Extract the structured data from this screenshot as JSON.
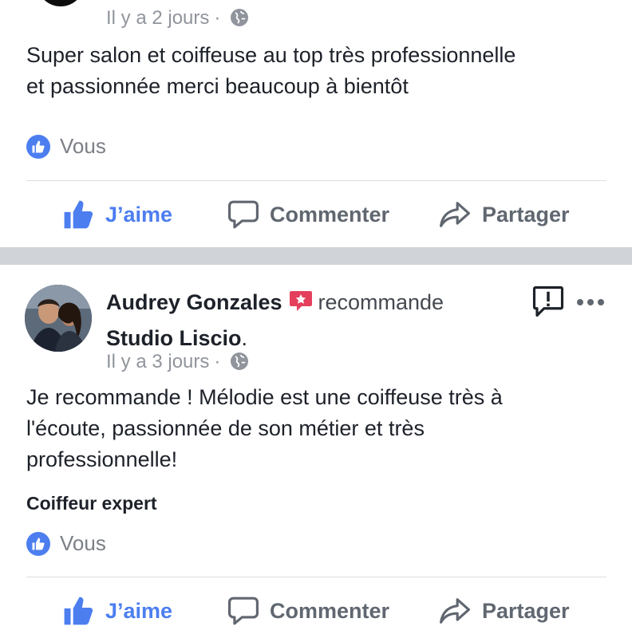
{
  "post1": {
    "time": "Il y a 2 jours",
    "text_line1": "Super salon et coiffeuse au top très professionnelle",
    "text_line2": "et passionnée merci beaucoup à bientôt",
    "reactions": "Vous"
  },
  "post2": {
    "author": "Audrey Gonzales",
    "verb": "recommande",
    "page": "Studio Liscio",
    "time": "Il y a 3 jours",
    "text_line1": "Je recommande ! Mélodie est une coiffeuse très à",
    "text_line2": "l'écoute, passionnée de son métier et très",
    "text_line3": "professionnelle!",
    "tag": "Coiffeur expert",
    "reactions": "Vous"
  },
  "actions": {
    "like": "J’aime",
    "comment": "Commenter",
    "share": "Partager"
  },
  "colors": {
    "accent": "#4c7ef0",
    "recommend": "#e4405c",
    "meta": "#90949c"
  },
  "icons": [
    "globe-icon",
    "thumbs-up-icon",
    "comment-icon",
    "share-icon",
    "recommend-badge-icon",
    "report-icon",
    "more-icon"
  ]
}
